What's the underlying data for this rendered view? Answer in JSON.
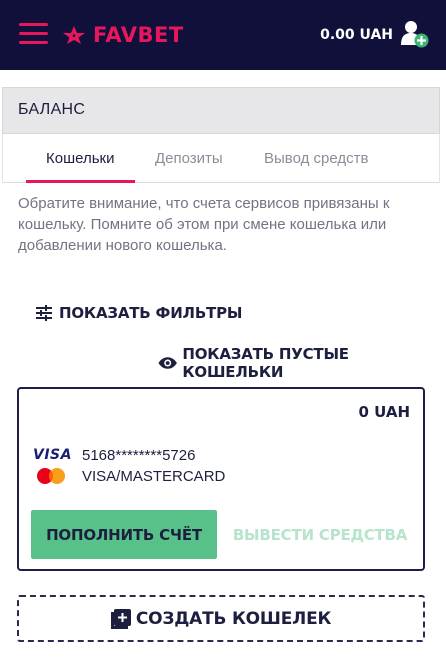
{
  "header": {
    "logo_text": "FAVBET",
    "balance": "0.00 UAH",
    "brand_color": "#e6175c",
    "bg_color": "#10103b",
    "menu_icon": "hamburger-menu-icon",
    "user_icon": "user-add-icon"
  },
  "section": {
    "title": "БАЛАНС"
  },
  "tabs": [
    {
      "label": "Кошельки",
      "active": true
    },
    {
      "label": "Депозиты",
      "active": false
    },
    {
      "label": "Вывод средств",
      "active": false
    }
  ],
  "notice": "Обратите внимание, что счета сервисов привязаны к кошельку. Помните об этом при смене кошелька или добавлении нового кошелька.",
  "actions": {
    "show_filters": "ПОКАЗАТЬ ФИЛЬТРЫ",
    "show_empty": "ПОКАЗАТЬ ПУСТЫЕ КОШЕЛЬКИ",
    "filters_icon": "sliders-icon",
    "empty_icon": "eye-icon"
  },
  "wallet": {
    "amount": "0 UAH",
    "visa_label": "VISA",
    "card_number": "5168********5726",
    "card_type": "VISA/MASTERCARD",
    "topup_label": "ПОПОЛНИТЬ СЧЁТ",
    "withdraw_label": "ВЫВЕСТИ СРЕДСТВА",
    "accent_green": "#58c18a"
  },
  "create_wallet": {
    "label": "СОЗДАТЬ КОШЕЛЕК",
    "icon": "add-box-icon"
  }
}
